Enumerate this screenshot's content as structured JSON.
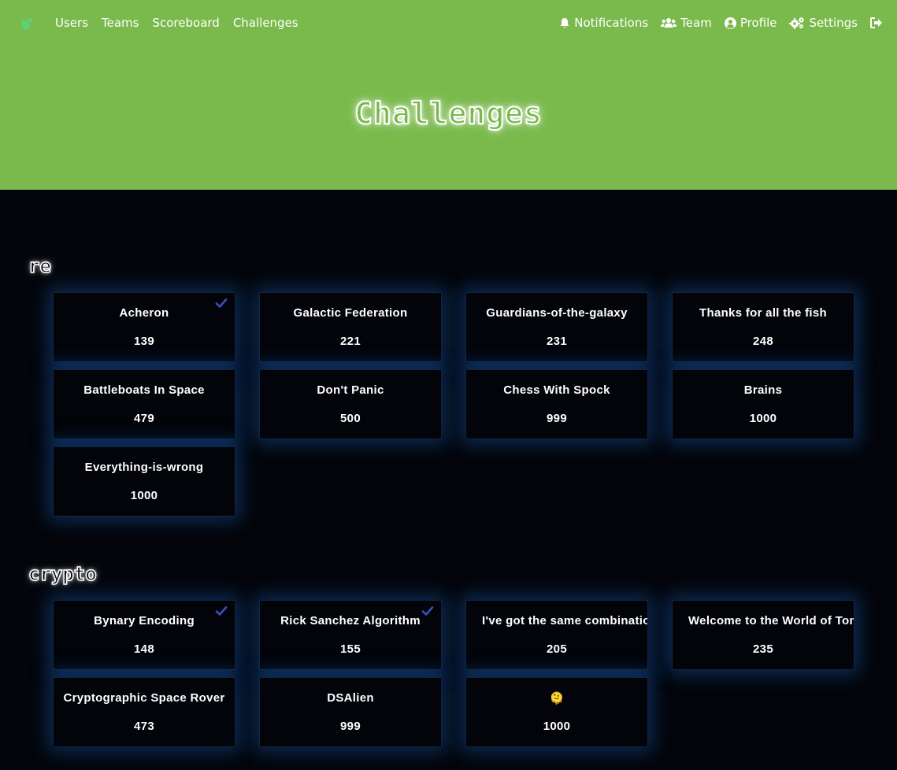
{
  "nav": {
    "left_links": [
      "Users",
      "Teams",
      "Scoreboard",
      "Challenges"
    ],
    "right_links": [
      {
        "label": "Notifications",
        "icon": "bell-icon"
      },
      {
        "label": "Team",
        "icon": "users-icon"
      },
      {
        "label": "Profile",
        "icon": "user-circle-icon"
      },
      {
        "label": "Settings",
        "icon": "cogs-icon"
      }
    ],
    "logout_icon": "logout-icon"
  },
  "page": {
    "title": "Challenges"
  },
  "colors": {
    "brand_green": "#7ab94c",
    "background": "#03050a",
    "card_glow": "#1f5aa8",
    "solved_check": "#3d4fc2"
  },
  "categories": [
    {
      "name": "re",
      "challenges": [
        {
          "name": "Acheron",
          "value": "139",
          "solved": true
        },
        {
          "name": "Galactic Federation",
          "value": "221",
          "solved": false
        },
        {
          "name": "Guardians-of-the-galaxy",
          "value": "231",
          "solved": false
        },
        {
          "name": "Thanks for all the fish",
          "value": "248",
          "solved": false
        },
        {
          "name": "Battleboats In Space",
          "value": "479",
          "solved": false
        },
        {
          "name": "Don't Panic",
          "value": "500",
          "solved": false
        },
        {
          "name": "Chess With Spock",
          "value": "999",
          "solved": false
        },
        {
          "name": "Brains",
          "value": "1000",
          "solved": false
        },
        {
          "name": "Everything-is-wrong",
          "value": "1000",
          "solved": false
        }
      ]
    },
    {
      "name": "crypto",
      "challenges": [
        {
          "name": "Bynary Encoding",
          "value": "148",
          "solved": true
        },
        {
          "name": "Rick Sanchez Algorithm",
          "value": "155",
          "solved": true
        },
        {
          "name": "I've got the same combination",
          "value": "205",
          "solved": false
        },
        {
          "name": "Welcome to the World of Tomorrow",
          "value": "235",
          "solved": false
        },
        {
          "name": "Cryptographic Space Rover",
          "value": "473",
          "solved": false
        },
        {
          "name": "DSAlien",
          "value": "999",
          "solved": false
        },
        {
          "name": "🫠",
          "value": "1000",
          "solved": false
        }
      ]
    }
  ]
}
